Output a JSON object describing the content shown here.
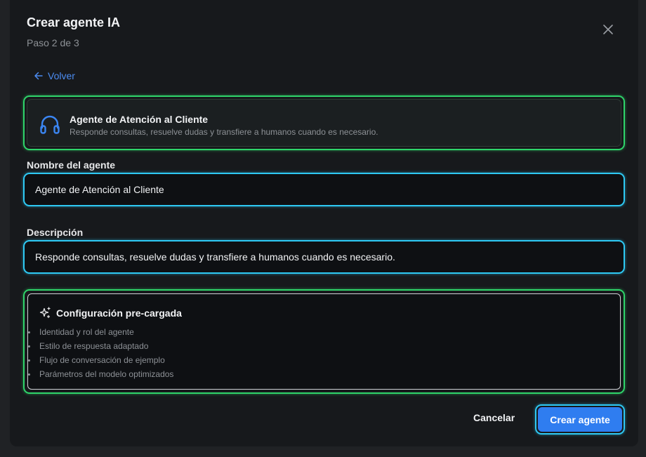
{
  "header": {
    "title": "Crear agente IA",
    "step": "Paso 2 de 3",
    "close_icon": "close-icon"
  },
  "back": {
    "label": "Volver",
    "icon": "arrow-left-icon"
  },
  "template": {
    "icon": "headset-icon",
    "name": "Agente de Atención al Cliente",
    "description": "Responde consultas, resuelve dudas y transfiere a humanos cuando es necesario."
  },
  "fields": {
    "name": {
      "label": "Nombre del agente",
      "value": "Agente de Atención al Cliente"
    },
    "description": {
      "label": "Descripción",
      "value": "Responde consultas, resuelve dudas y transfiere a humanos cuando es necesario."
    }
  },
  "preload": {
    "icon": "sparkles-icon",
    "title": "Configuración pre-cargada",
    "items": [
      "Identidad y rol del agente",
      "Estilo de respuesta adaptado",
      "Flujo de conversación de ejemplo",
      "Parámetros del modelo optimizados"
    ]
  },
  "actions": {
    "cancel": "Cancelar",
    "create": "Crear agente"
  },
  "colors": {
    "accent": "#2f7df0",
    "highlight_green": "#2fd46a",
    "highlight_cyan": "#2ec9f4",
    "background": "#17191c"
  }
}
